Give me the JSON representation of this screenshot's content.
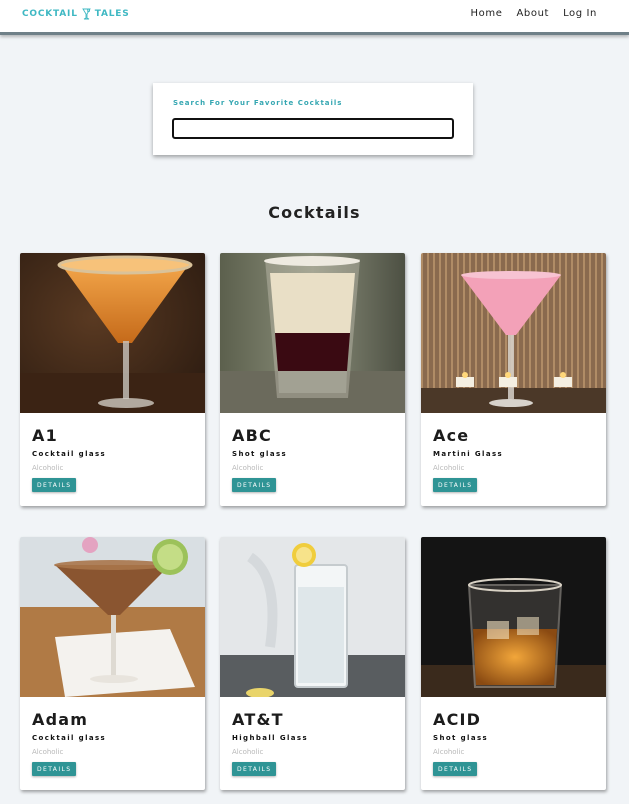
{
  "navbar": {
    "brand_left": "COCKTAIL",
    "brand_right": "TALES",
    "brand_icon": "cocktail-glass-icon",
    "links": [
      "Home",
      "About",
      "Log In"
    ]
  },
  "search": {
    "label": "Search For Your Favorite Cocktails",
    "value": "",
    "placeholder": ""
  },
  "section": {
    "title": "Cocktails"
  },
  "cards": [
    {
      "name": "A1",
      "glass": "Cocktail glass",
      "type": "Alcoholic",
      "button": "DETAILS"
    },
    {
      "name": "ABC",
      "glass": "Shot glass",
      "type": "Alcoholic",
      "button": "DETAILS"
    },
    {
      "name": "Ace",
      "glass": "Martini Glass",
      "type": "Alcoholic",
      "button": "DETAILS"
    },
    {
      "name": "Adam",
      "glass": "Cocktail glass",
      "type": "Alcoholic",
      "button": "DETAILS"
    },
    {
      "name": "AT&T",
      "glass": "Highball Glass",
      "type": "Alcoholic",
      "button": "DETAILS"
    },
    {
      "name": "ACID",
      "glass": "Shot glass",
      "type": "Alcoholic",
      "button": "DETAILS"
    }
  ],
  "colors": {
    "accent": "#3fb8c3",
    "button": "#2f9495",
    "background": "#f1f4f7",
    "navbar_border": "#6f8088"
  }
}
